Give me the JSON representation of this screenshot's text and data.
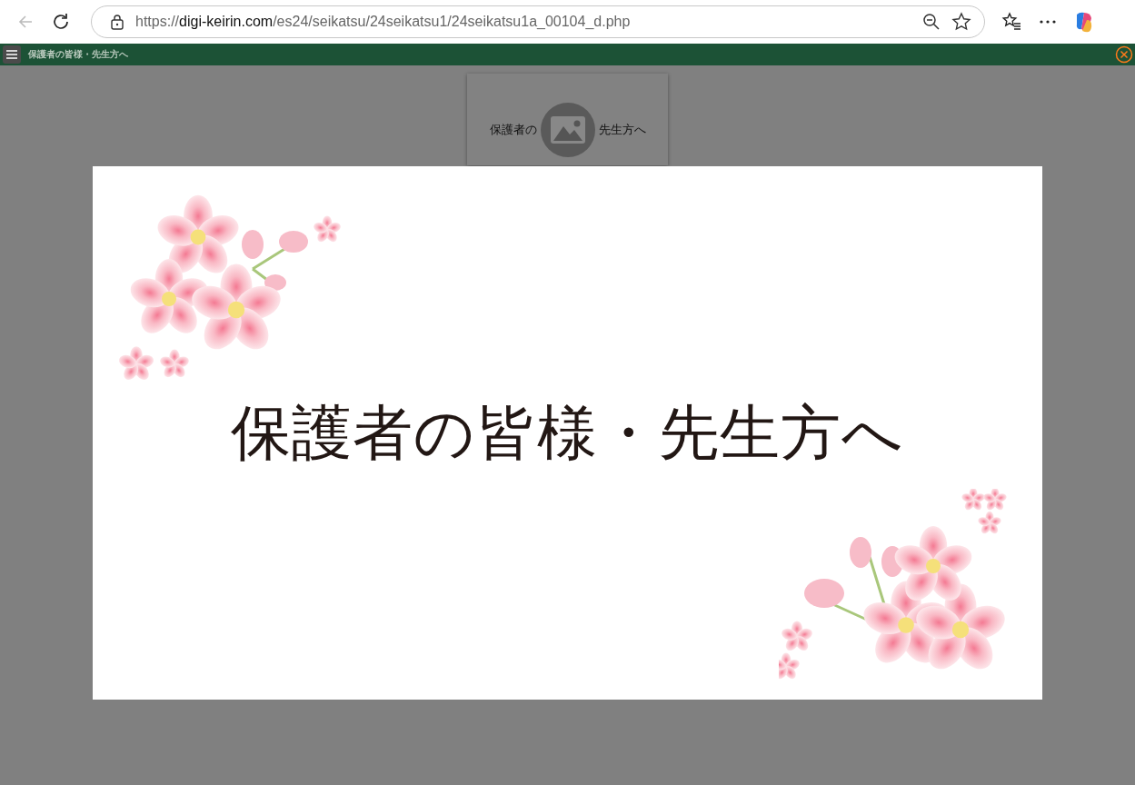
{
  "browser": {
    "url": "https://**digi-keirin.com**/es24/seikatsu/24seikatsu1/24seikatsu1a_00104_d.php"
  },
  "header_bar": {
    "title": "保護者の皆様・先生方へ"
  },
  "thumbnail": {
    "text_left": "保護者の",
    "text_right": "先生方へ"
  },
  "slide": {
    "heading": "保護者の皆様・先生方へ"
  }
}
